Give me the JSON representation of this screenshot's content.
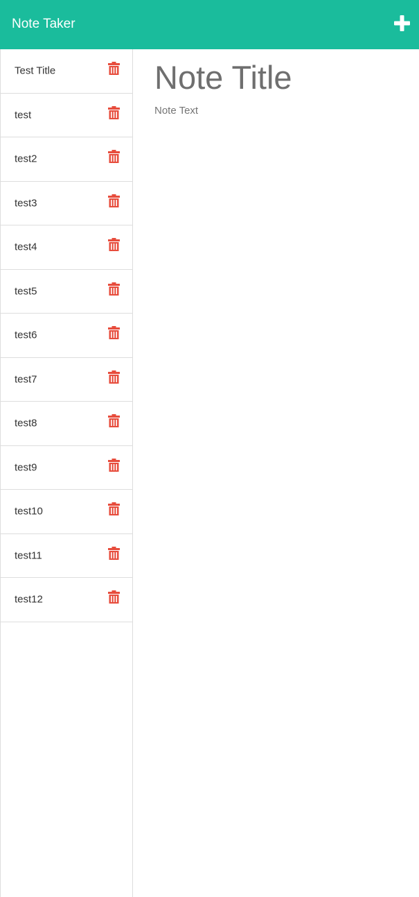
{
  "header": {
    "brand": "Note Taker",
    "new_note_icon": "plus-icon",
    "background_color": "#1abc9c"
  },
  "sidebar": {
    "delete_icon": "trash-icon",
    "delete_color": "#e74c3c",
    "notes": [
      {
        "title": "Test Title"
      },
      {
        "title": "test"
      },
      {
        "title": "test2"
      },
      {
        "title": "test3"
      },
      {
        "title": "test4"
      },
      {
        "title": "test5"
      },
      {
        "title": "test6"
      },
      {
        "title": "test7"
      },
      {
        "title": "test8"
      },
      {
        "title": "test9"
      },
      {
        "title": "test10"
      },
      {
        "title": "test11"
      },
      {
        "title": "test12"
      }
    ]
  },
  "editor": {
    "title_value": "",
    "title_placeholder": "Note Title",
    "text_value": "",
    "text_placeholder": "Note Text"
  }
}
